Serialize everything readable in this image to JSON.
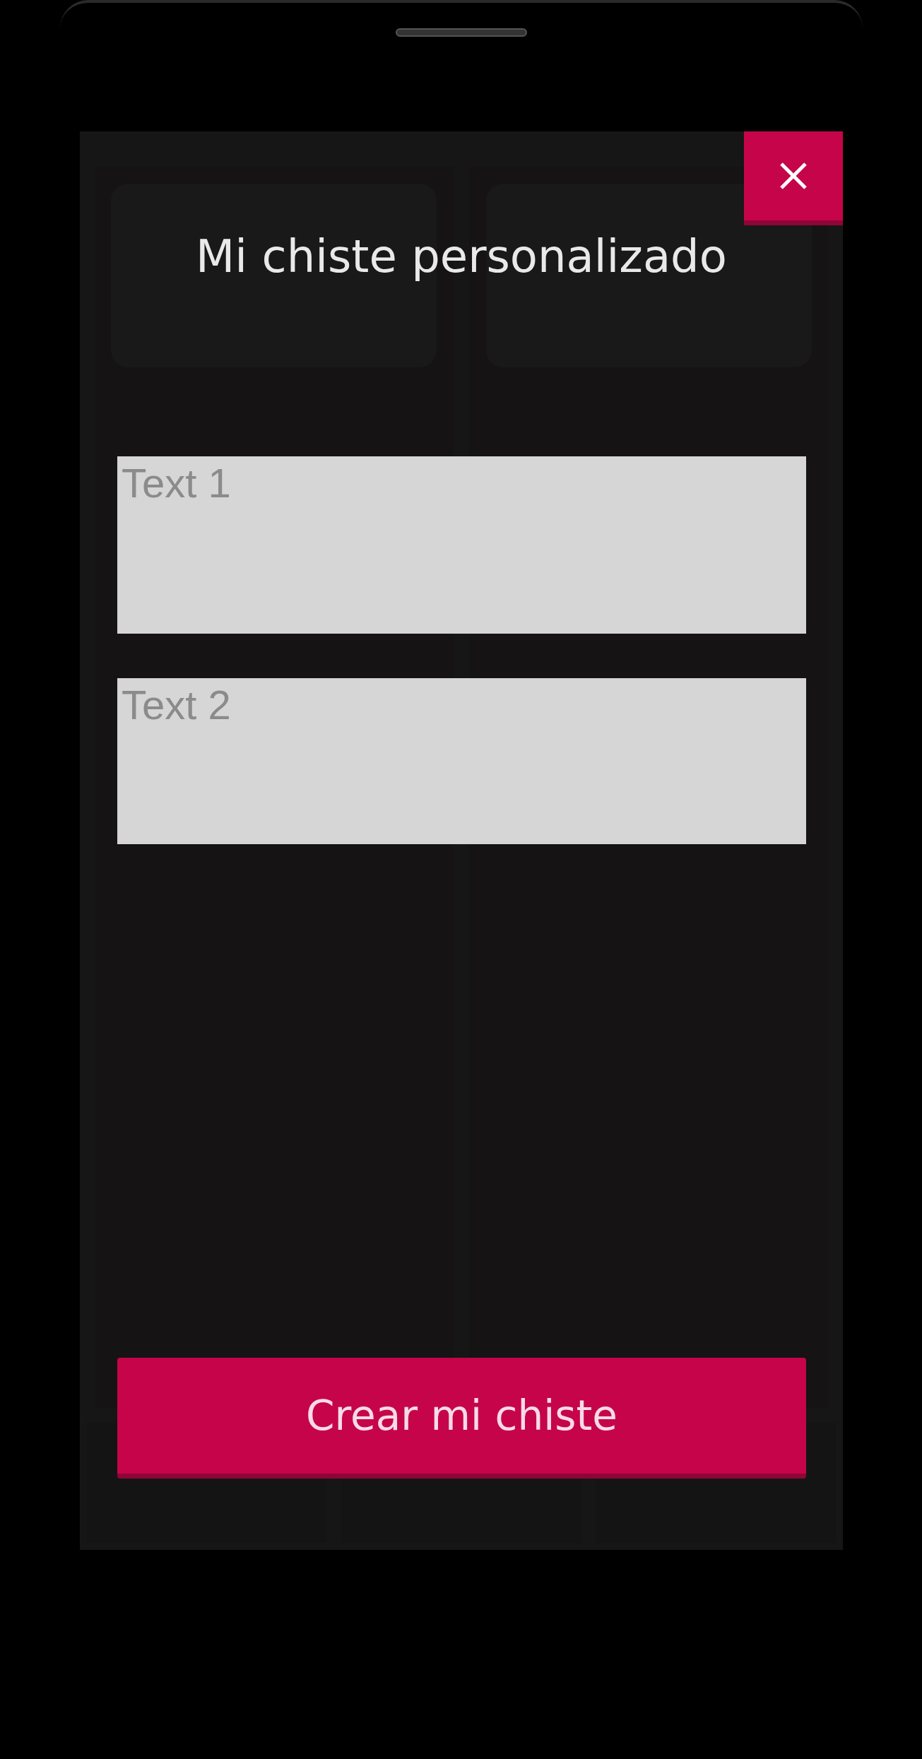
{
  "modal": {
    "title": "Mi chiste personalizado",
    "fields": [
      {
        "placeholder": "Text 1"
      },
      {
        "placeholder": "Text 2"
      }
    ],
    "submit": "Crear mi chiste"
  }
}
